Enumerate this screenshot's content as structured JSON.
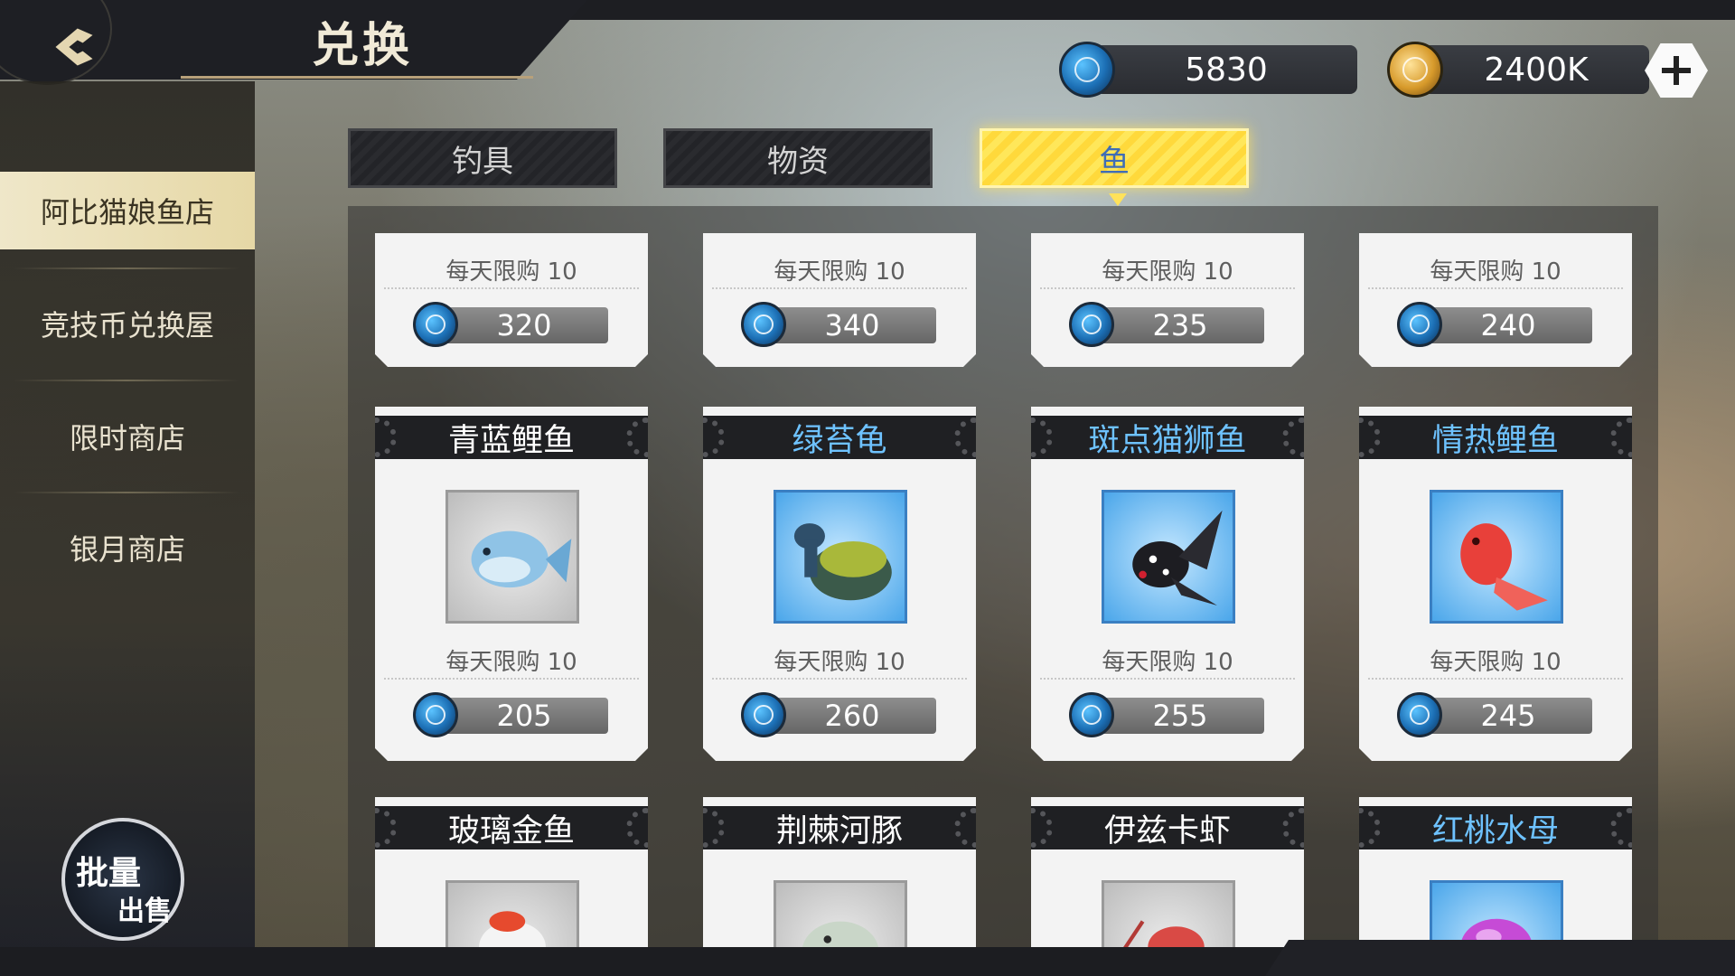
{
  "header": {
    "title": "兑换"
  },
  "currencies": {
    "blue_coin": {
      "value": "5830",
      "icon": "blue-coin-icon"
    },
    "gold_coin": {
      "value": "2400K",
      "icon": "gold-coin-icon"
    }
  },
  "sidebar": {
    "items": [
      {
        "label": "阿比猫娘鱼店",
        "active": true
      },
      {
        "label": "竞技币兑换屋",
        "active": false
      },
      {
        "label": "限时商店",
        "active": false
      },
      {
        "label": "银月商店",
        "active": false
      }
    ],
    "bulk_sell": {
      "line1": "批量",
      "line2": "出售"
    }
  },
  "tabs": [
    {
      "label": "钓具",
      "active": false
    },
    {
      "label": "物资",
      "active": false
    },
    {
      "label": "鱼",
      "active": true
    }
  ],
  "top_row": [
    {
      "limit": "每天限购  10",
      "price": "320"
    },
    {
      "limit": "每天限购  10",
      "price": "340"
    },
    {
      "limit": "每天限购  10",
      "price": "235"
    },
    {
      "limit": "每天限购  10",
      "price": "240"
    }
  ],
  "middle_row": [
    {
      "name": "青蓝鲤鱼",
      "name_color": "white",
      "frame": "gray",
      "limit": "每天限购  10",
      "price": "205",
      "icon": "cyan-carp-icon"
    },
    {
      "name": "绿苔龟",
      "name_color": "blue",
      "frame": "blue",
      "limit": "每天限购  10",
      "price": "260",
      "icon": "moss-turtle-icon"
    },
    {
      "name": "斑点猫狮鱼",
      "name_color": "blue",
      "frame": "blue",
      "limit": "每天限购  10",
      "price": "255",
      "icon": "spotted-lionhead-fish-icon"
    },
    {
      "name": "情热鲤鱼",
      "name_color": "blue",
      "frame": "blue",
      "limit": "每天限购  10",
      "price": "245",
      "icon": "passion-carp-icon"
    }
  ],
  "bottom_row": [
    {
      "name": "玻璃金鱼",
      "name_color": "white",
      "frame": "gray",
      "icon": "glass-goldfish-icon"
    },
    {
      "name": "荆棘河豚",
      "name_color": "white",
      "frame": "gray",
      "icon": "thorn-pufferfish-icon"
    },
    {
      "name": "伊兹卡虾",
      "name_color": "white",
      "frame": "gray",
      "icon": "izka-shrimp-icon"
    },
    {
      "name": "红桃水母",
      "name_color": "blue",
      "frame": "blue",
      "icon": "heart-jellyfish-icon"
    }
  ]
}
